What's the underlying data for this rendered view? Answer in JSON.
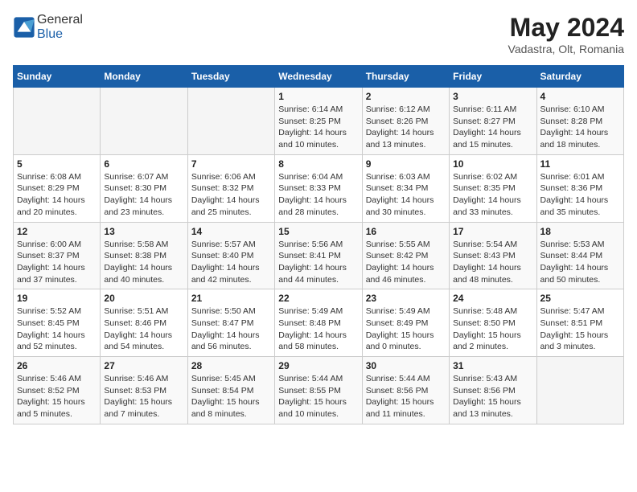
{
  "header": {
    "logo_general": "General",
    "logo_blue": "Blue",
    "month_year": "May 2024",
    "location": "Vadastra, Olt, Romania"
  },
  "weekdays": [
    "Sunday",
    "Monday",
    "Tuesday",
    "Wednesday",
    "Thursday",
    "Friday",
    "Saturday"
  ],
  "weeks": [
    [
      {
        "day": "",
        "sunrise": "",
        "sunset": "",
        "daylight": ""
      },
      {
        "day": "",
        "sunrise": "",
        "sunset": "",
        "daylight": ""
      },
      {
        "day": "",
        "sunrise": "",
        "sunset": "",
        "daylight": ""
      },
      {
        "day": "1",
        "sunrise": "6:14 AM",
        "sunset": "8:25 PM",
        "daylight": "14 hours and 10 minutes."
      },
      {
        "day": "2",
        "sunrise": "6:12 AM",
        "sunset": "8:26 PM",
        "daylight": "14 hours and 13 minutes."
      },
      {
        "day": "3",
        "sunrise": "6:11 AM",
        "sunset": "8:27 PM",
        "daylight": "14 hours and 15 minutes."
      },
      {
        "day": "4",
        "sunrise": "6:10 AM",
        "sunset": "8:28 PM",
        "daylight": "14 hours and 18 minutes."
      }
    ],
    [
      {
        "day": "5",
        "sunrise": "6:08 AM",
        "sunset": "8:29 PM",
        "daylight": "14 hours and 20 minutes."
      },
      {
        "day": "6",
        "sunrise": "6:07 AM",
        "sunset": "8:30 PM",
        "daylight": "14 hours and 23 minutes."
      },
      {
        "day": "7",
        "sunrise": "6:06 AM",
        "sunset": "8:32 PM",
        "daylight": "14 hours and 25 minutes."
      },
      {
        "day": "8",
        "sunrise": "6:04 AM",
        "sunset": "8:33 PM",
        "daylight": "14 hours and 28 minutes."
      },
      {
        "day": "9",
        "sunrise": "6:03 AM",
        "sunset": "8:34 PM",
        "daylight": "14 hours and 30 minutes."
      },
      {
        "day": "10",
        "sunrise": "6:02 AM",
        "sunset": "8:35 PM",
        "daylight": "14 hours and 33 minutes."
      },
      {
        "day": "11",
        "sunrise": "6:01 AM",
        "sunset": "8:36 PM",
        "daylight": "14 hours and 35 minutes."
      }
    ],
    [
      {
        "day": "12",
        "sunrise": "6:00 AM",
        "sunset": "8:37 PM",
        "daylight": "14 hours and 37 minutes."
      },
      {
        "day": "13",
        "sunrise": "5:58 AM",
        "sunset": "8:38 PM",
        "daylight": "14 hours and 40 minutes."
      },
      {
        "day": "14",
        "sunrise": "5:57 AM",
        "sunset": "8:40 PM",
        "daylight": "14 hours and 42 minutes."
      },
      {
        "day": "15",
        "sunrise": "5:56 AM",
        "sunset": "8:41 PM",
        "daylight": "14 hours and 44 minutes."
      },
      {
        "day": "16",
        "sunrise": "5:55 AM",
        "sunset": "8:42 PM",
        "daylight": "14 hours and 46 minutes."
      },
      {
        "day": "17",
        "sunrise": "5:54 AM",
        "sunset": "8:43 PM",
        "daylight": "14 hours and 48 minutes."
      },
      {
        "day": "18",
        "sunrise": "5:53 AM",
        "sunset": "8:44 PM",
        "daylight": "14 hours and 50 minutes."
      }
    ],
    [
      {
        "day": "19",
        "sunrise": "5:52 AM",
        "sunset": "8:45 PM",
        "daylight": "14 hours and 52 minutes."
      },
      {
        "day": "20",
        "sunrise": "5:51 AM",
        "sunset": "8:46 PM",
        "daylight": "14 hours and 54 minutes."
      },
      {
        "day": "21",
        "sunrise": "5:50 AM",
        "sunset": "8:47 PM",
        "daylight": "14 hours and 56 minutes."
      },
      {
        "day": "22",
        "sunrise": "5:49 AM",
        "sunset": "8:48 PM",
        "daylight": "14 hours and 58 minutes."
      },
      {
        "day": "23",
        "sunrise": "5:49 AM",
        "sunset": "8:49 PM",
        "daylight": "15 hours and 0 minutes."
      },
      {
        "day": "24",
        "sunrise": "5:48 AM",
        "sunset": "8:50 PM",
        "daylight": "15 hours and 2 minutes."
      },
      {
        "day": "25",
        "sunrise": "5:47 AM",
        "sunset": "8:51 PM",
        "daylight": "15 hours and 3 minutes."
      }
    ],
    [
      {
        "day": "26",
        "sunrise": "5:46 AM",
        "sunset": "8:52 PM",
        "daylight": "15 hours and 5 minutes."
      },
      {
        "day": "27",
        "sunrise": "5:46 AM",
        "sunset": "8:53 PM",
        "daylight": "15 hours and 7 minutes."
      },
      {
        "day": "28",
        "sunrise": "5:45 AM",
        "sunset": "8:54 PM",
        "daylight": "15 hours and 8 minutes."
      },
      {
        "day": "29",
        "sunrise": "5:44 AM",
        "sunset": "8:55 PM",
        "daylight": "15 hours and 10 minutes."
      },
      {
        "day": "30",
        "sunrise": "5:44 AM",
        "sunset": "8:56 PM",
        "daylight": "15 hours and 11 minutes."
      },
      {
        "day": "31",
        "sunrise": "5:43 AM",
        "sunset": "8:56 PM",
        "daylight": "15 hours and 13 minutes."
      },
      {
        "day": "",
        "sunrise": "",
        "sunset": "",
        "daylight": ""
      }
    ]
  ],
  "labels": {
    "sunrise_prefix": "Sunrise: ",
    "sunset_prefix": "Sunset: ",
    "daylight_prefix": "Daylight: "
  }
}
